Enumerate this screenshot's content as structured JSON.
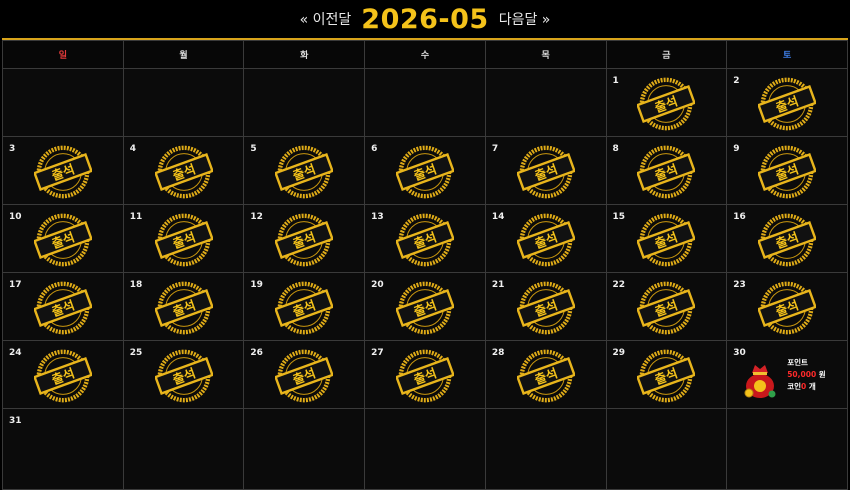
{
  "nav": {
    "prev": "« 이전달",
    "next": "다음달 »",
    "title": "2026-05"
  },
  "weekdays": [
    "일",
    "월",
    "화",
    "수",
    "목",
    "금",
    "토"
  ],
  "stamp_label": "출석",
  "colors": {
    "gold": "#f4c21a",
    "sunday": "#e23a3a",
    "saturday": "#3f7fe8",
    "reward_highlight": "#ff2a2a"
  },
  "days": {
    "1": "1",
    "2": "2",
    "3": "3",
    "4": "4",
    "5": "5",
    "6": "6",
    "7": "7",
    "8": "8",
    "9": "9",
    "10": "10",
    "11": "11",
    "12": "12",
    "13": "13",
    "14": "14",
    "15": "15",
    "16": "16",
    "17": "17",
    "18": "18",
    "19": "19",
    "20": "20",
    "21": "21",
    "22": "22",
    "23": "23",
    "24": "24",
    "25": "25",
    "26": "26",
    "27": "27",
    "28": "28",
    "29": "29",
    "30": "30",
    "31": "31"
  },
  "reward": {
    "label": "포인트",
    "points": "50,000",
    "points_unit": "원",
    "coin_label": "코인",
    "coin_count": "0",
    "coin_unit": "개",
    "icon": "money-bag-icon"
  }
}
